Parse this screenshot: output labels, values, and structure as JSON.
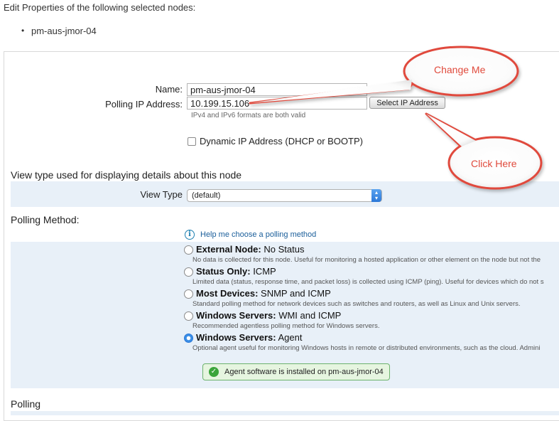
{
  "header": {
    "title": "Edit Properties of the following selected nodes:",
    "nodes": [
      "pm-aus-jmor-04"
    ]
  },
  "form": {
    "name_label": "Name:",
    "name_value": "pm-aus-jmor-04",
    "ip_label": "Polling IP Address:",
    "ip_value": "10.199.15.106",
    "select_ip_button": "Select IP Address",
    "ip_hint": "IPv4 and IPv6 formats are both valid",
    "dynamic_ip_label": "Dynamic IP Address (DHCP or BOOTP)"
  },
  "view_type": {
    "section_title": "View type used for displaying details about this node",
    "label": "View Type",
    "selected": "(default)"
  },
  "polling_method": {
    "section_title": "Polling Method:",
    "help_link": "Help me choose a polling method",
    "options": [
      {
        "bold": "External Node:",
        "rest": " No Status",
        "desc": "No data is collected for this node. Useful for monitoring a hosted application or other element on the node but not the",
        "selected": false
      },
      {
        "bold": "Status Only:",
        "rest": " ICMP",
        "desc": "Limited data (status, response time, and packet loss) is collected using ICMP (ping). Useful for devices which do not s",
        "selected": false
      },
      {
        "bold": "Most Devices:",
        "rest": " SNMP and ICMP",
        "desc": "Standard polling method for network devices such as switches and routers, as well as Linux and Unix servers.",
        "selected": false
      },
      {
        "bold": "Windows Servers:",
        "rest": " WMI and ICMP",
        "desc": "Recommended agentless polling method for Windows servers.",
        "selected": false
      },
      {
        "bold": "Windows Servers:",
        "rest": " Agent",
        "desc": "Optional agent useful for monitoring Windows hosts in remote or distributed environments, such as the cloud. Admini",
        "selected": true
      }
    ],
    "agent_status": "Agent software is installed on pm-aus-jmor-04"
  },
  "polling": {
    "section_title": "Polling"
  },
  "annotations": {
    "change_me": "Change Me",
    "click_here": "Click Here",
    "color": "#e04a3c"
  }
}
